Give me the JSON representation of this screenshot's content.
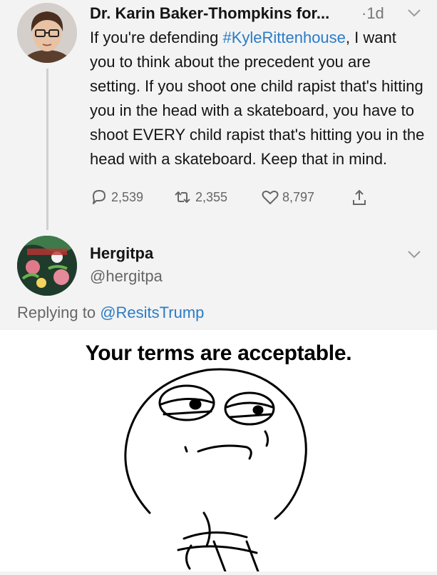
{
  "tweet": {
    "author": "Dr. Karin Baker-Thompkins for...",
    "time": "·1d",
    "text_before": "If you're defending ",
    "hashtag": "#KyleRittenhouse",
    "text_after": ", I want you to think about the precedent you are setting. If you shoot one child rapist that's hitting you in the head with a skateboard, you have to shoot EVERY child rapist that's hitting you in the head with a skateboard. Keep that in mind.",
    "replies": "2,539",
    "retweets": "2,355",
    "likes": "8,797"
  },
  "reply_tweet": {
    "author": "Hergitpa",
    "handle": "@hergitpa",
    "replying_prefix": "Replying to ",
    "replying_to": "@ResitsTrump",
    "meme_caption": "Your terms are acceptable."
  },
  "colors": {
    "link": "#2a7cc7",
    "muted": "#666666"
  },
  "icons": [
    "reply-icon",
    "retweet-icon",
    "like-icon",
    "share-icon",
    "chevron-down-icon"
  ]
}
